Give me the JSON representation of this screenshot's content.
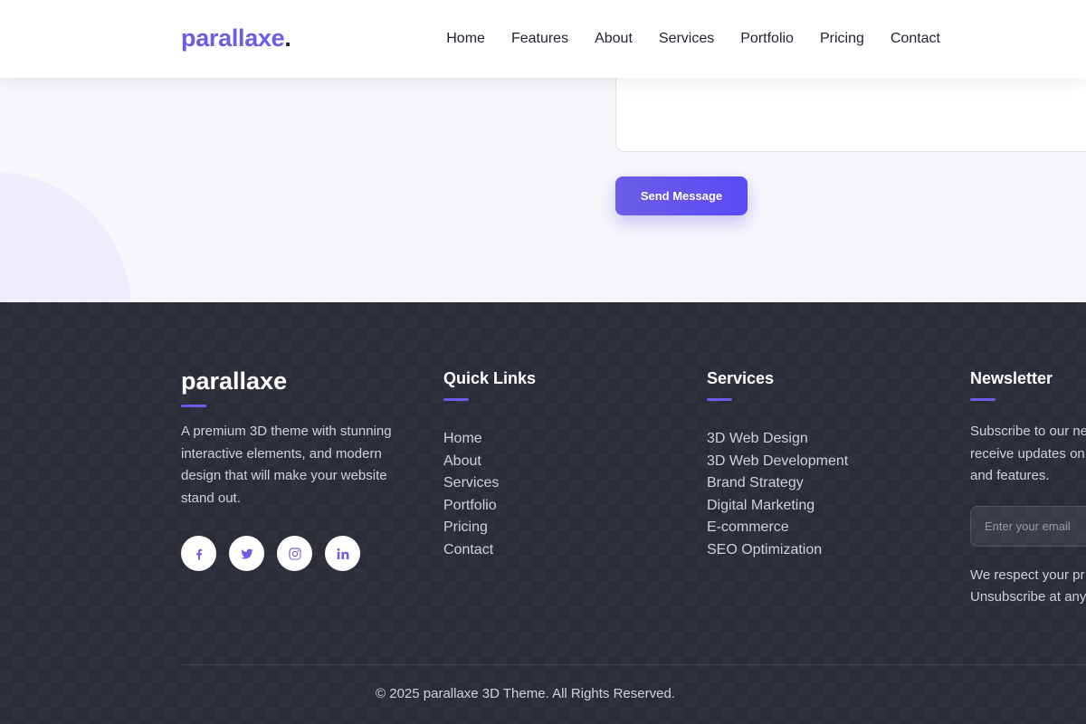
{
  "header": {
    "logo_text": "parallaxe",
    "logo_dot": ".",
    "nav": [
      "Home",
      "Features",
      "About",
      "Services",
      "Portfolio",
      "Pricing",
      "Contact"
    ]
  },
  "contact": {
    "send_label": "Send Message"
  },
  "footer": {
    "brand": "parallaxe",
    "description": "A premium 3D theme with stunning interactive elements, and modern design that will make your website stand out.",
    "socials": [
      "facebook-icon",
      "twitter-icon",
      "instagram-icon",
      "linkedin-icon"
    ],
    "quick_links": {
      "title": "Quick Links",
      "items": [
        "Home",
        "About",
        "Services",
        "Portfolio",
        "Pricing",
        "Contact"
      ]
    },
    "services": {
      "title": "Services",
      "items": [
        "3D Web Design",
        "3D Web Development",
        "Brand Strategy",
        "Digital Marketing",
        "E-commerce",
        "SEO Optimization"
      ]
    },
    "newsletter": {
      "title": "Newsletter",
      "text_lines": [
        "Subscribe to our ne",
        "receive updates on",
        "and features."
      ],
      "email_placeholder": "Enter your email",
      "privacy_lines": [
        "We respect your pr",
        "Unsubscribe at any"
      ]
    },
    "copyright": "© 2025 parallaxe 3D Theme. All Rights Reserved."
  },
  "colors": {
    "accent": "#6c5ce7",
    "footer_bg": "#2a2d38"
  }
}
